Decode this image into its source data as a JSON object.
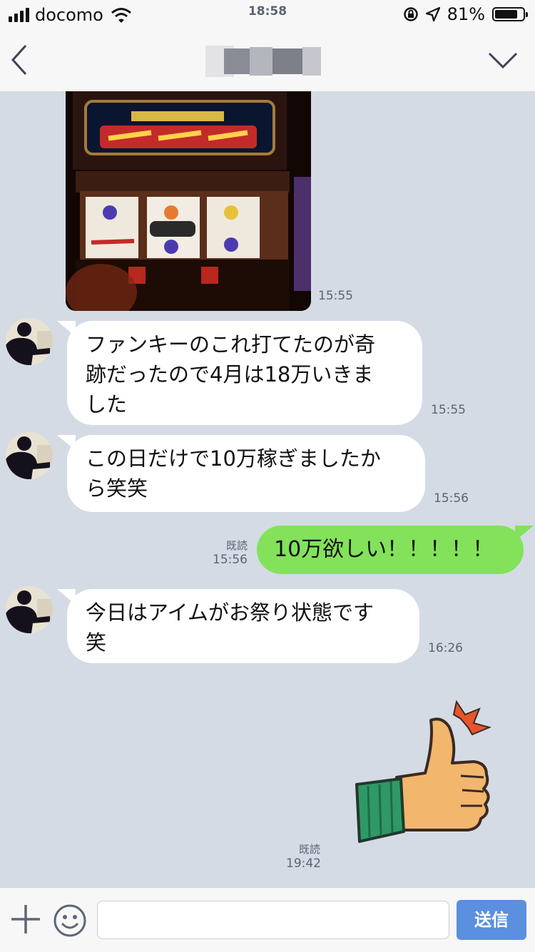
{
  "status": {
    "carrier": "docomo",
    "time": "18:58",
    "battery": "81%",
    "battery_level": 0.81
  },
  "header": {
    "back_icon": "chevron-left-icon",
    "menu_icon": "chevron-down-icon"
  },
  "messages": [
    {
      "type": "image",
      "time": "15:55"
    },
    {
      "type": "text",
      "side": "in",
      "text_lines": [
        "ファンキーのこれ打てたのが奇",
        "跡だったので4月は18万いきま",
        "した"
      ],
      "time": "15:55"
    },
    {
      "type": "text",
      "side": "in",
      "text_lines": [
        "この日だけで10万稼ぎましたか",
        "ら笑笑"
      ],
      "time": "15:56"
    },
    {
      "type": "text",
      "side": "out",
      "text": "10万欲しい！！！！！",
      "read": "既読",
      "time": "15:56"
    },
    {
      "type": "text",
      "side": "in",
      "text_lines": [
        "今日はアイムがお祭り状態です",
        "笑"
      ],
      "time": "16:26"
    },
    {
      "type": "sticker",
      "side": "out",
      "sticker": "thumbs-up",
      "read": "既読",
      "time": "19:42"
    }
  ],
  "input": {
    "send_label": "送信",
    "placeholder": ""
  },
  "colors": {
    "background": "#d5dbe5",
    "out_bubble": "#83e25a",
    "send": "#5b8fe0"
  }
}
